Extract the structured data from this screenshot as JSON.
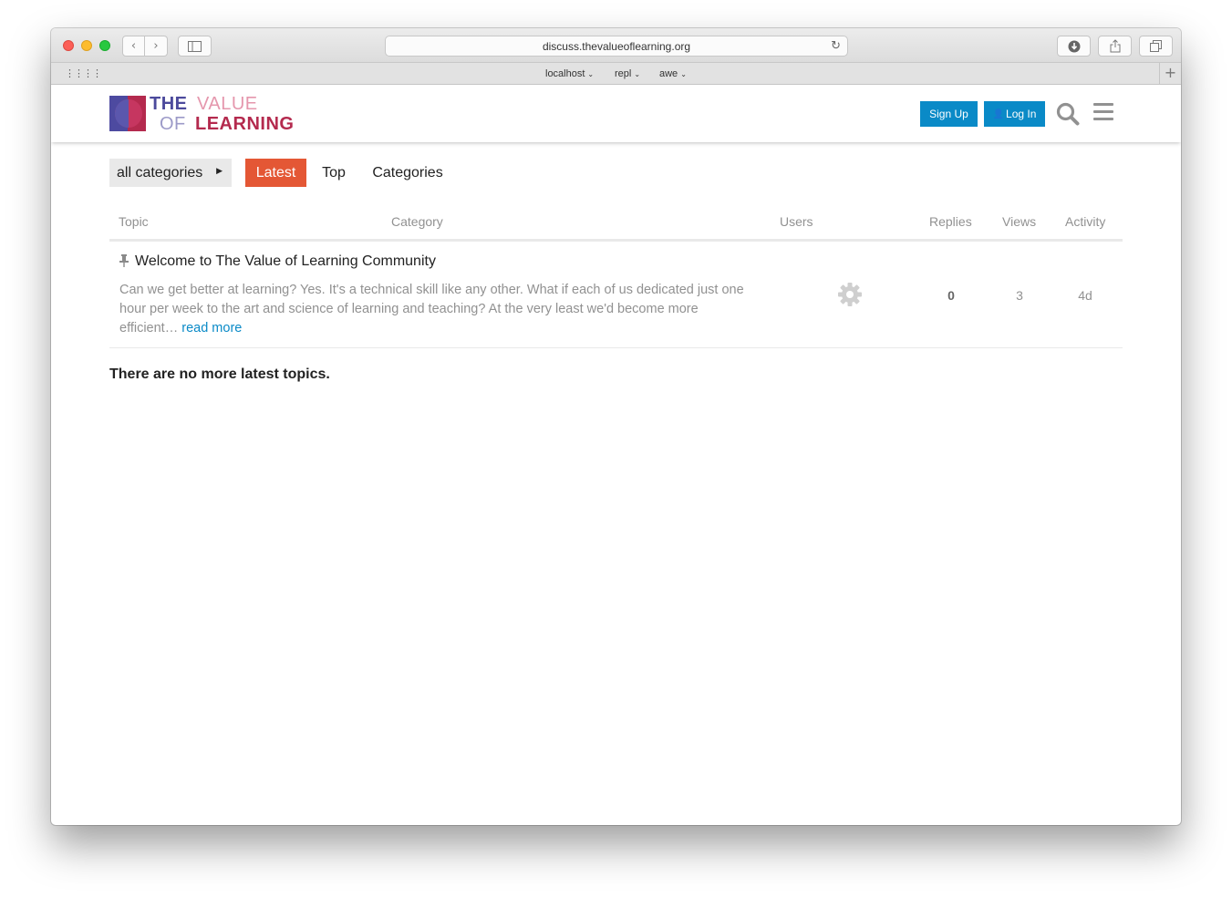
{
  "browser": {
    "url": "discuss.thevalueoflearning.org",
    "favorites": [
      {
        "label": "localhost"
      },
      {
        "label": "repl"
      },
      {
        "label": "awe"
      }
    ],
    "icons": {
      "back": "chevron-left-icon",
      "forward": "chevron-right-icon",
      "sidebar": "sidebar-icon",
      "reload": "reload-icon",
      "download": "download-icon",
      "share": "share-icon",
      "tabs": "tabs-icon",
      "new_tab": "plus-icon",
      "top_sites": "grid-icon"
    }
  },
  "header": {
    "logo": {
      "line1a": "THE",
      "line1b": "VALUE",
      "line2a": "OF",
      "line2b": "LEARNING"
    },
    "signup_label": "Sign Up",
    "login_label": "Log In",
    "colors": {
      "button": "#0a8ac7",
      "logo_purple": "#4c4a9c",
      "logo_red": "#b42a4e"
    }
  },
  "nav": {
    "category_dropdown": "all categories",
    "pills": [
      {
        "label": "Latest",
        "active": true
      },
      {
        "label": "Top",
        "active": false
      },
      {
        "label": "Categories",
        "active": false
      }
    ],
    "active_color": "#e45735"
  },
  "table": {
    "headers": {
      "topic": "Topic",
      "category": "Category",
      "users": "Users",
      "replies": "Replies",
      "views": "Views",
      "activity": "Activity"
    },
    "rows": [
      {
        "pinned": true,
        "title": "Welcome to The Value of Learning Community",
        "excerpt": "Can we get better at learning? Yes. It's a technical skill like any other. What if each of us dedicated just one hour per week to the art and science of learning and teaching? At the very least we'd become more efficient…",
        "read_more": "read more",
        "replies": "0",
        "views": "3",
        "activity": "4d"
      }
    ]
  },
  "footer_message": "There are no more latest topics."
}
